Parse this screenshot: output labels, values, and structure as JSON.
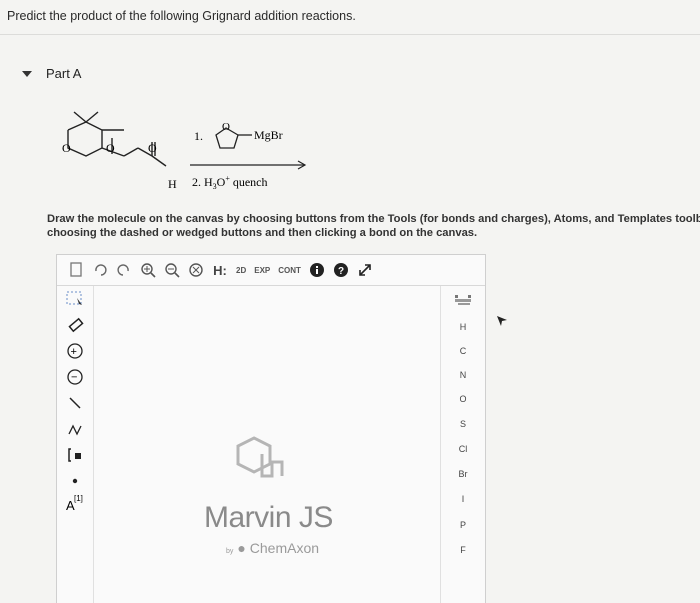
{
  "question": "Predict the product of the following Grignard addition reactions.",
  "part": {
    "title": "Part A"
  },
  "scheme": {
    "step1": "1.",
    "reagent": "MgBr",
    "step2_prefix": "2. H",
    "step2_sub": "3",
    "step2_o": "O",
    "step2_sup": "+",
    "step2_suffix": " quench",
    "atom_o": "O",
    "atom_h": "H"
  },
  "instructions": {
    "line1": "Draw the molecule on the canvas by choosing buttons from the Tools (for bonds and charges), Atoms, and Templates toolba",
    "line2": "choosing the dashed or wedged buttons and then clicking a bond on the canvas."
  },
  "toolbar": {
    "h_label": "H:",
    "twod_label": "2D",
    "exp_label": "EXP",
    "cont_label": "CONT",
    "help_label": "?"
  },
  "left_tools": {
    "plus_label": "+",
    "minus_label": "−",
    "atom_map_label": "A",
    "atom_map_sup": "[1]"
  },
  "atoms": [
    "H",
    "C",
    "N",
    "O",
    "S",
    "Cl",
    "Br",
    "I",
    "P",
    "F"
  ],
  "editor": {
    "brand": "Marvin JS",
    "by": "by",
    "company": "ChemAxon"
  }
}
